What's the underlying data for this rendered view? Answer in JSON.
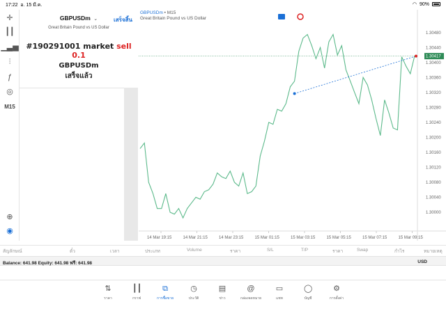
{
  "status_bar": {
    "time": "17:22",
    "date": "อ. 15 มี.ค.",
    "battery": "90%"
  },
  "order_panel": {
    "symbol": "GBPUSDm",
    "symbol_desc": "Great Britain Pound vs US Dollar",
    "done": "เสร็จสิ้น",
    "order_prefix": "#190291001 market ",
    "order_sell": "sell 0.1",
    "order_symbol": "GBPUSDm",
    "order_status": "เสร็จแล้ว"
  },
  "chart": {
    "title_symbol": "GBPUSDm",
    "title_tf": " • M15",
    "description": "Great Britain Pound vs US Dollar",
    "timeframe_label": "M15",
    "current_price": "1.30417"
  },
  "chart_data": {
    "type": "line",
    "ylim": [
      1.2995,
      1.305
    ],
    "y_ticks": [
      "1.30480",
      "1.30440",
      "1.30400",
      "1.30360",
      "1.30320",
      "1.30280",
      "1.30240",
      "1.30200",
      "1.30160",
      "1.30120",
      "1.30080",
      "1.30040",
      "1.30000"
    ],
    "x_ticks": [
      "14 Mar 19:15",
      "14 Mar 21:15",
      "14 Mar 23:15",
      "15 Mar 01:15",
      "15 Mar 03:15",
      "15 Mar 05:15",
      "15 Mar 07:15",
      "15 Mar 09:15"
    ],
    "values": [
      1.3017,
      1.30185,
      1.3008,
      1.3005,
      1.3001,
      1.3001,
      1.3005,
      1.3,
      1.29995,
      1.3001,
      1.29985,
      1.3001,
      1.30025,
      1.3004,
      1.30035,
      1.30055,
      1.3006,
      1.30075,
      1.30105,
      1.30095,
      1.3009,
      1.3011,
      1.3008,
      1.3007,
      1.30105,
      1.3005,
      1.30055,
      1.3007,
      1.3015,
      1.3019,
      1.3024,
      1.30235,
      1.30275,
      1.3027,
      1.3029,
      1.30335,
      1.3035,
      1.3043,
      1.30465,
      1.30475,
      1.30445,
      1.3041,
      1.3044,
      1.30385,
      1.30455,
      1.30475,
      1.3042,
      1.30445,
      1.3038,
      1.3035,
      1.3032,
      1.3029,
      1.3036,
      1.3034,
      1.303,
      1.3025,
      1.30205,
      1.303,
      1.30265,
      1.30225,
      1.3022,
      1.30415,
      1.3039,
      1.3037,
      1.30418
    ],
    "entry_price": 1.30317,
    "bid_price": 1.30417,
    "colors": {
      "line": "#5bb98a",
      "entry": "#1a6fd6",
      "bid_bg": "#2e8b57",
      "sl_marker": "#d22"
    }
  },
  "toolbar": {
    "icons": [
      "crosshair-icon",
      "candles-icon",
      "bars-icon",
      "indicators-icon",
      "function-icon",
      "objects-icon"
    ],
    "bottom_icons": [
      "zoom-icon",
      "trading-icon"
    ]
  },
  "table_headers": [
    "สัญลักษณ์",
    "ตั๋ว",
    "เวลา",
    "ประเภท",
    "Volume",
    "ราคา",
    "S/L",
    "T/P",
    "ราคา",
    "Swap",
    "กำไร",
    "หมายเหตุ"
  ],
  "balance": {
    "text": "Balance: 641.98 Equity: 641.98 ฟรี: 641.98",
    "currency": "USD"
  },
  "tabs": [
    {
      "label": "ราคา",
      "icon": "quotes-icon"
    },
    {
      "label": "กราฟ",
      "icon": "chart-icon"
    },
    {
      "label": "การซื้อขาย",
      "icon": "trade-icon"
    },
    {
      "label": "ประวัติ",
      "icon": "history-icon"
    },
    {
      "label": "ข่าว",
      "icon": "news-icon"
    },
    {
      "label": "กล่องจดหมาย",
      "icon": "mailbox-icon"
    },
    {
      "label": "แชท",
      "icon": "chat-icon"
    },
    {
      "label": "บัญชี",
      "icon": "account-icon"
    },
    {
      "label": "การตั้งค่า",
      "icon": "settings-icon"
    }
  ]
}
